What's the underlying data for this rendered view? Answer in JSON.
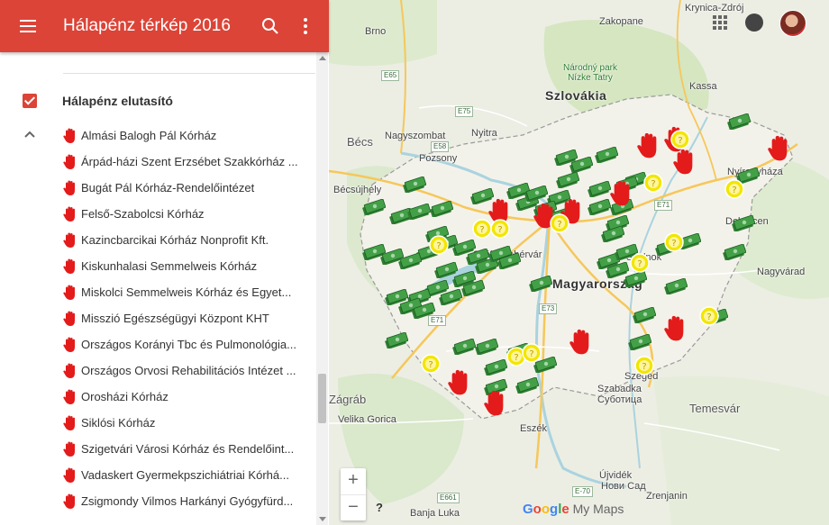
{
  "app": {
    "title": "Hálapénz térkép 2016",
    "menu_icon": "hamburger-menu-icon",
    "search_icon": "search-icon",
    "more_icon": "more-vert-icon",
    "accent_color": "#db4437"
  },
  "sidebar": {
    "layer_title": "Hálapénz elutasító",
    "layer_checked": true,
    "items": [
      {
        "label": "Almási Balogh Pál Kórház"
      },
      {
        "label": "Árpád-házi Szent Erzsébet Szakkórház ..."
      },
      {
        "label": "Bugát Pál Kórház-Rendelőintézet"
      },
      {
        "label": "Felső-Szabolcsi Kórház"
      },
      {
        "label": "Kazincbarcikai Kórház Nonprofit Kft."
      },
      {
        "label": "Kiskunhalasi Semmelweis Kórház"
      },
      {
        "label": "Miskolci Semmelweis Kórház és Egyet..."
      },
      {
        "label": "Misszió Egészségügyi Központ KHT"
      },
      {
        "label": "Országos Korányi Tbc és Pulmonológia..."
      },
      {
        "label": "Országos Orvosi Rehabilitációs Intézet ..."
      },
      {
        "label": "Orosházi Kórház"
      },
      {
        "label": "Siklósi Kórház"
      },
      {
        "label": "Szigetvári Városi Kórház és Rendelőint..."
      },
      {
        "label": "Vadaskert Gyermekpszichiátriai Kórhá..."
      },
      {
        "label": "Zsigmondy Vilmos Harkányi Gyógyfürd..."
      }
    ]
  },
  "map": {
    "places": {
      "brno": "Brno",
      "zakopane": "Zakopane",
      "krynica": "Krynica-Zdrój",
      "narodny_park": "Národný park Nízke Tatry",
      "szlovakia": "Szlovákia",
      "kassa": "Kassa",
      "becs": "Bécs",
      "nagyszombat": "Nagyszombat",
      "nyitra": "Nyitra",
      "pozsony": "Pozsony",
      "becsujhely": "Bécsújhely",
      "nyiregyhaza": "Nyíregyháza",
      "debrecen": "Debrecen",
      "nagyvarad": "Nagyvárad",
      "szekesfehervar": "Székesfehérvár",
      "magyarorszag": "Magyarország",
      "szolnok": "Szolnok",
      "szeged": "Szeged",
      "szabadka": "Szabadka",
      "subotica": "Суботица",
      "temesvar": "Temesvár",
      "zagrab": "Zágráb",
      "velika_gorica": "Velika Gorica",
      "eszek": "Eszék",
      "ujvidek": "Újvidék",
      "novi_sad": "Нови Сад",
      "zrenjanin": "Zrenjanin",
      "banja_luka": "Banja Luka"
    },
    "roads": [
      "E65",
      "E75",
      "E58",
      "E71",
      "E71",
      "E73",
      "E661",
      "E-70"
    ],
    "zoom_in": "+",
    "zoom_out": "−",
    "help": "?",
    "logo_google": [
      "G",
      "o",
      "o",
      "g",
      "l",
      "e"
    ],
    "logo_suffix": " My Maps"
  }
}
